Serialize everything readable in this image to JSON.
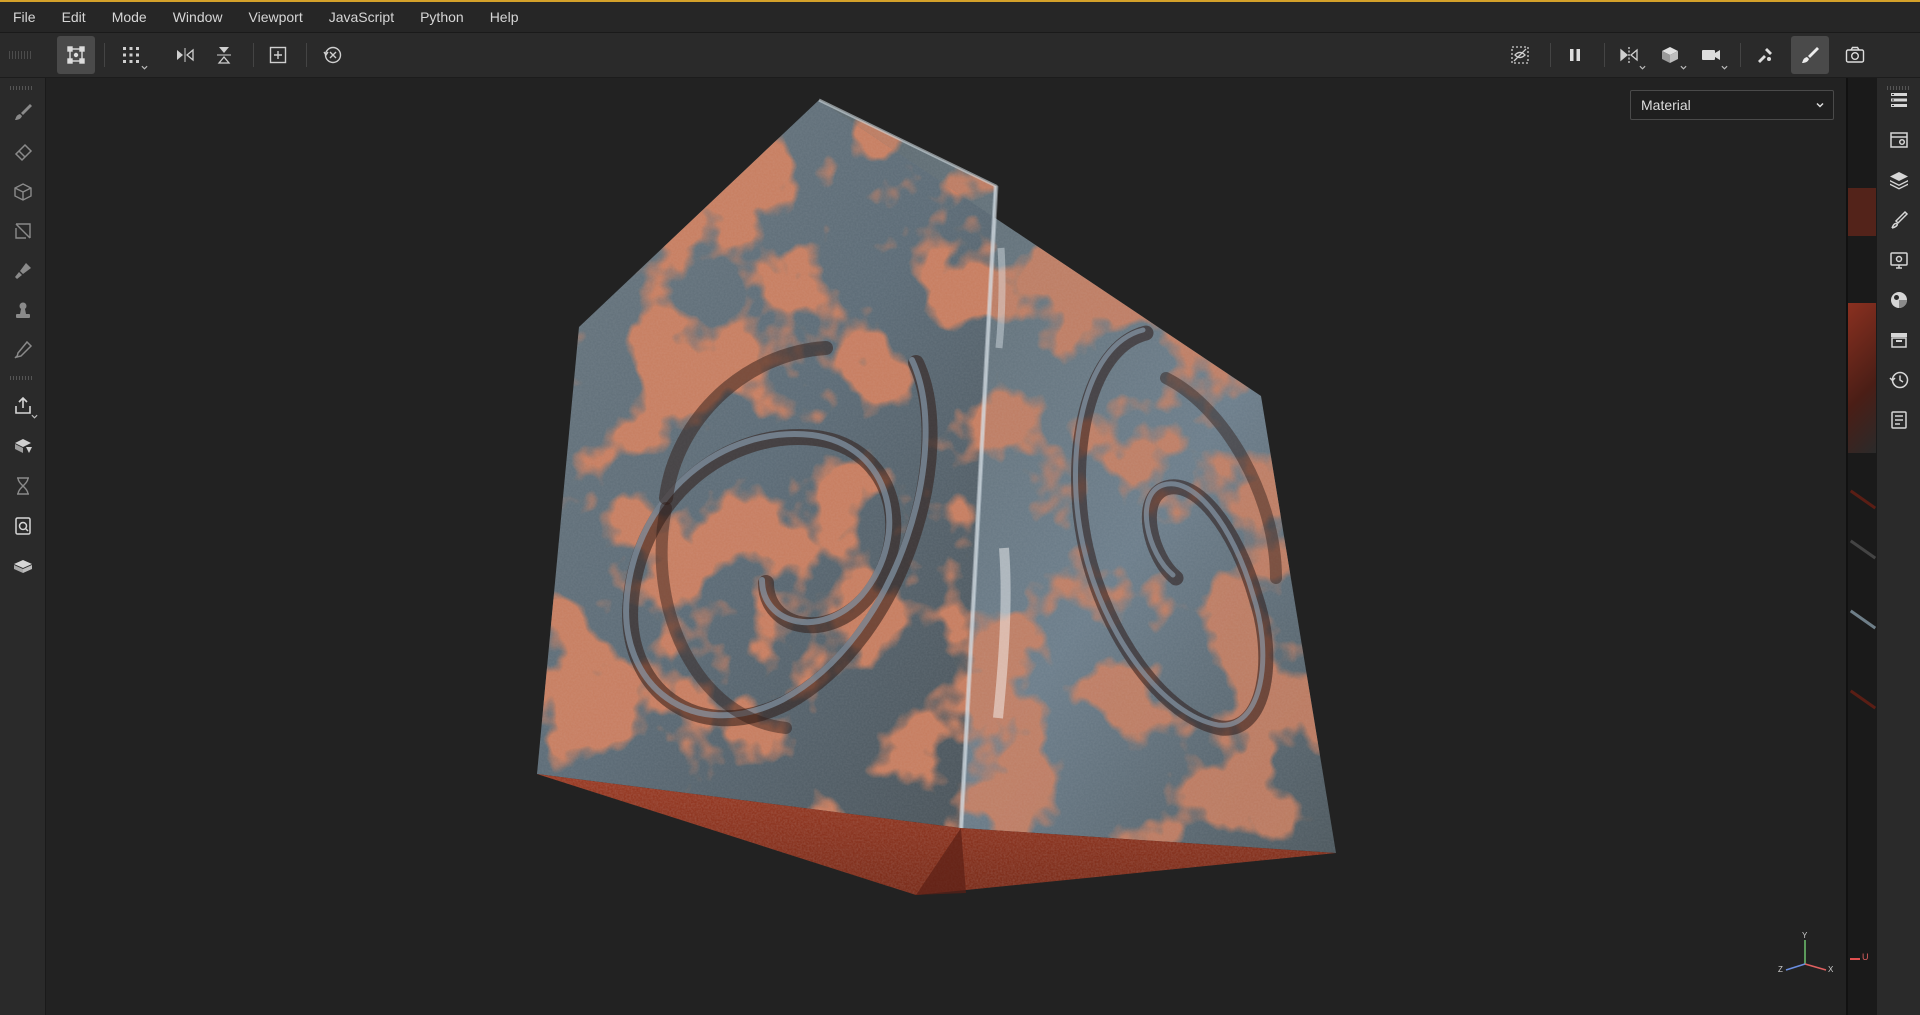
{
  "menu": {
    "items": [
      "File",
      "Edit",
      "Mode",
      "Window",
      "Viewport",
      "JavaScript",
      "Python",
      "Help"
    ]
  },
  "toolbar": {
    "left_tools": [
      "transform-icon",
      "grid-snap-icon",
      "mirror-x-icon",
      "mirror-y-icon",
      "focus-icon",
      "reset-icon"
    ],
    "right_tools": [
      "hide-selection-icon",
      "pause-icon",
      "symmetry-icon",
      "cube-view-icon",
      "camera-icon",
      "bake-icon",
      "paint-mode-icon",
      "screenshot-icon"
    ]
  },
  "left_tools": [
    "paint-brush-icon",
    "eraser-icon",
    "projection-icon",
    "polygon-fill-icon",
    "smudge-icon",
    "clone-stamp-icon",
    "color-picker-icon",
    "export-icon",
    "bake-mesh-icon",
    "history-icon",
    "display-icon",
    "mesh-icon"
  ],
  "right_panels": [
    "texture-set-list-icon",
    "texture-set-settings-icon",
    "layers-icon",
    "properties-icon",
    "display-settings-icon",
    "shader-settings-icon",
    "assets-icon",
    "history-icon",
    "log-icon"
  ],
  "viewport": {
    "channel_select": "Material",
    "axis": {
      "y": "Y",
      "x": "X",
      "z": "Z"
    },
    "uv_label": "U"
  },
  "colors": {
    "accent": "#d4a12a",
    "rust": "#a8442a",
    "metal": "#6d7c86"
  }
}
